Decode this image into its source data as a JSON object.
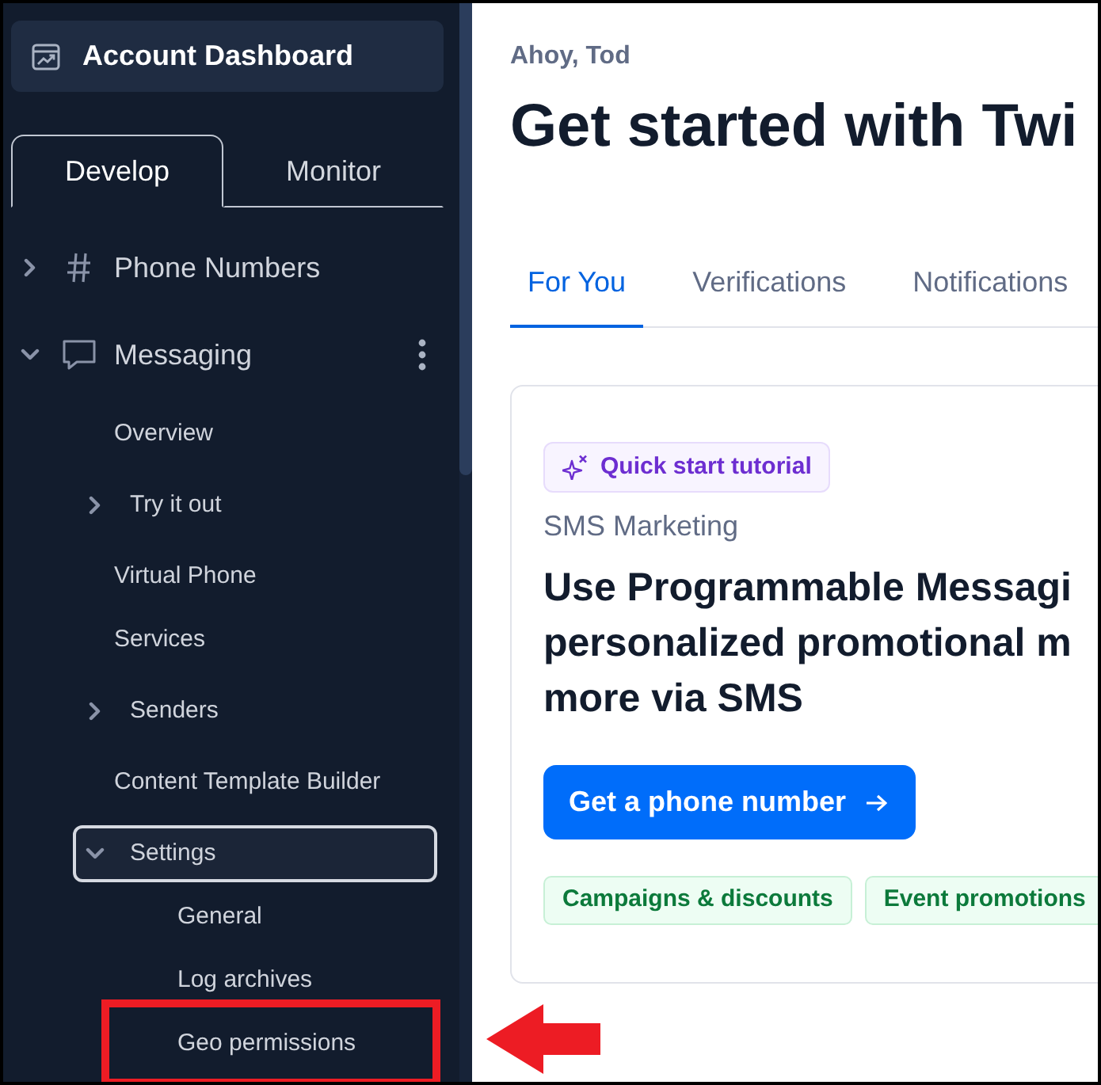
{
  "sidebar": {
    "dashboard_button": {
      "label": "Account Dashboard"
    },
    "tabs": [
      {
        "label": "Develop",
        "selected": true
      },
      {
        "label": "Monitor",
        "selected": false
      }
    ],
    "items": [
      {
        "label": "Phone Numbers",
        "kind": "group",
        "expanded": false,
        "has_menu": false,
        "selected": false,
        "highlighted": false
      },
      {
        "label": "Messaging",
        "kind": "group",
        "expanded": true,
        "has_menu": true,
        "selected": false,
        "highlighted": false,
        "children": [
          {
            "label": "Overview",
            "kind": "link",
            "selected": false,
            "highlighted": false
          },
          {
            "label": "Try it out",
            "kind": "group",
            "expanded": false,
            "selected": false,
            "highlighted": false
          },
          {
            "label": "Virtual Phone",
            "kind": "link",
            "selected": false,
            "highlighted": false
          },
          {
            "label": "Services",
            "kind": "link",
            "selected": false,
            "highlighted": false
          },
          {
            "label": "Senders",
            "kind": "group",
            "expanded": false,
            "selected": false,
            "highlighted": false
          },
          {
            "label": "Content Template Builder",
            "kind": "link",
            "selected": false,
            "highlighted": false
          },
          {
            "label": "Settings",
            "kind": "group",
            "expanded": true,
            "selected": true,
            "highlighted": false,
            "children": [
              {
                "label": "General",
                "kind": "link",
                "selected": false,
                "highlighted": false
              },
              {
                "label": "Log archives",
                "kind": "link",
                "selected": false,
                "highlighted": false
              },
              {
                "label": "Geo permissions",
                "kind": "link",
                "selected": false,
                "highlighted": true
              }
            ]
          }
        ]
      }
    ]
  },
  "main": {
    "greeting": "Ahoy, Tod",
    "title": "Get started with Twi",
    "tabs": [
      {
        "label": "For You",
        "selected": true
      },
      {
        "label": "Verifications",
        "selected": false
      },
      {
        "label": "Notifications",
        "selected": false
      }
    ],
    "card": {
      "badge": "Quick start tutorial",
      "category": "SMS Marketing",
      "headline_lines": [
        "Use Programmable Messagi",
        "personalized promotional m",
        "more via SMS"
      ],
      "button": "Get a phone number",
      "tags": [
        "Campaigns & discounts",
        "Event promotions"
      ]
    }
  }
}
